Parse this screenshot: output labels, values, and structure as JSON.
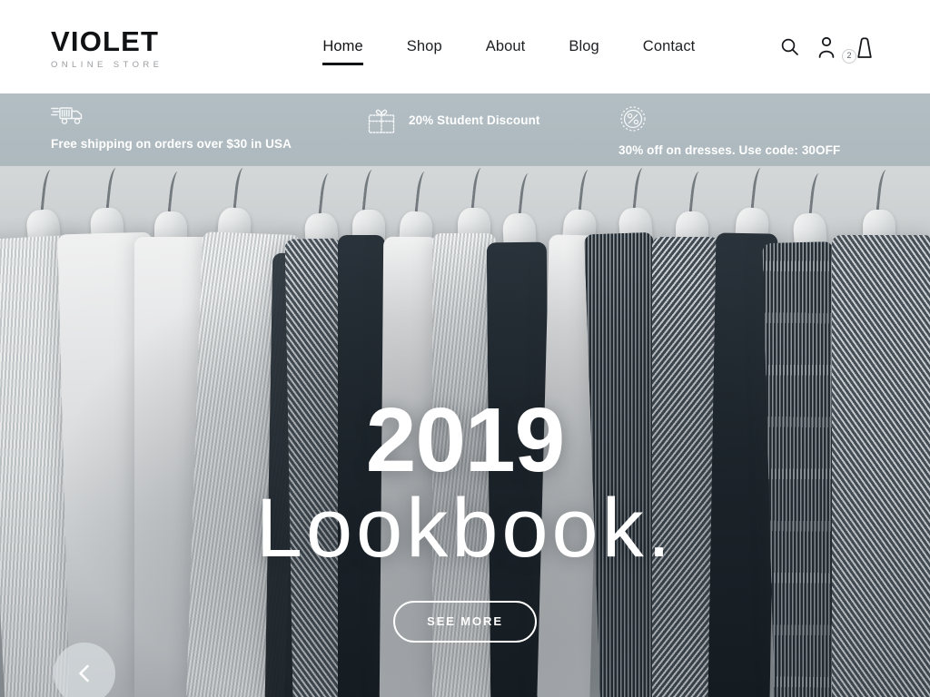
{
  "brand": {
    "name": "VIOLET",
    "tagline": "ONLINE STORE"
  },
  "nav": {
    "items": [
      {
        "label": "Home",
        "active": true
      },
      {
        "label": "Shop",
        "active": false
      },
      {
        "label": "About",
        "active": false
      },
      {
        "label": "Blog",
        "active": false
      },
      {
        "label": "Contact",
        "active": false
      }
    ]
  },
  "actions": {
    "search_icon": "search-icon",
    "account_icon": "user-icon",
    "cart_icon": "shopping-bag-icon",
    "cart_count": "2"
  },
  "promo": {
    "background_color": "#b0bcc1",
    "items": [
      {
        "icon": "delivery-truck-icon",
        "text": "Free shipping on orders over $30 in USA"
      },
      {
        "icon": "gift-box-icon",
        "text": "20% Student Discount"
      },
      {
        "icon": "discount-badge-icon",
        "text": "30% off on dresses. Use code: 30OFF"
      }
    ]
  },
  "hero": {
    "year": "2019",
    "title": "Lookbook.",
    "cta_label": "SEE MORE",
    "prev_icon": "chevron-left-icon",
    "image_alt": "Rack of pleated garments on white hangers"
  }
}
